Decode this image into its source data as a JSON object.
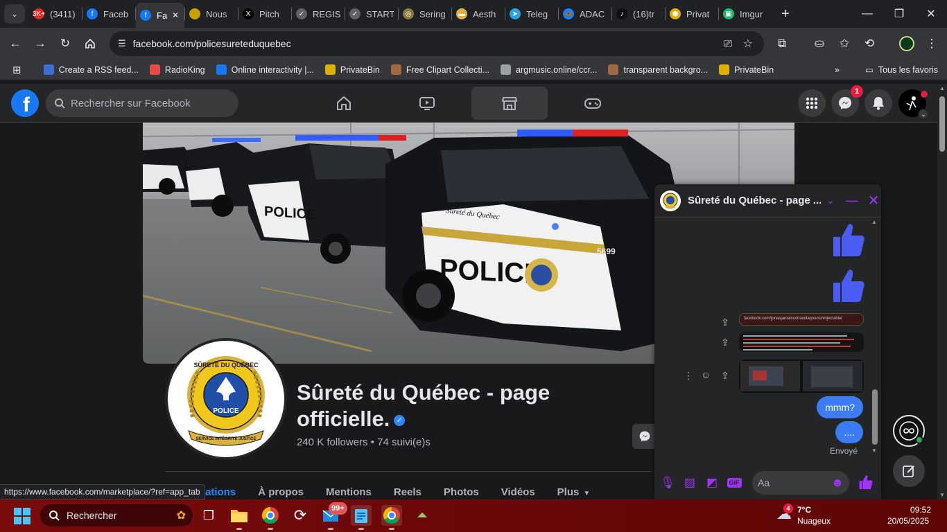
{
  "browser": {
    "tabs": [
      {
        "label": "(3411)",
        "icon": "red-badge-icon",
        "fav_text": "3K+",
        "color": "#d93025"
      },
      {
        "label": "Faceb",
        "icon": "facebook-icon",
        "fav_text": "f",
        "color": "#1877f2"
      },
      {
        "label": "Fa",
        "icon": "facebook-icon",
        "fav_text": "f",
        "color": "#1877f2",
        "active": true
      },
      {
        "label": "Nous",
        "icon": "sq-badge-icon",
        "fav_text": "",
        "color": "#c8a000"
      },
      {
        "label": "Pitch",
        "icon": "x-icon",
        "fav_text": "X",
        "color": "#000000"
      },
      {
        "label": "REGIS",
        "icon": "check-circle-icon",
        "fav_text": "✓",
        "color": "#5f6368"
      },
      {
        "label": "START",
        "icon": "check-circle-icon",
        "fav_text": "✓",
        "color": "#5f6368"
      },
      {
        "label": "Sering",
        "icon": "globe-icon",
        "fav_text": "◎",
        "color": "#8a7a40"
      },
      {
        "label": "Aesth",
        "icon": "folder-icon",
        "fav_text": "▬",
        "color": "#e0b040"
      },
      {
        "label": "Teleg",
        "icon": "telegram-icon",
        "fav_text": "➤",
        "color": "#2aa3e0"
      },
      {
        "label": "ADAC",
        "icon": "bluesky-icon",
        "fav_text": "🦋",
        "color": "#1185fe"
      },
      {
        "label": "(16)tr",
        "icon": "tiktok-icon",
        "fav_text": "♪",
        "color": "#111111"
      },
      {
        "label": "Privat",
        "icon": "privatebin-icon",
        "fav_text": "⬢",
        "color": "#e0b000"
      },
      {
        "label": "Imgur",
        "icon": "imgur-icon",
        "fav_text": "▣",
        "color": "#1bb76e"
      }
    ],
    "new_tab": "+",
    "url": "facebook.com/policesureteduquebec",
    "bookmarks": [
      {
        "label": "Create a RSS feed...",
        "icon": "rss-icon",
        "color": "#3a6fd8"
      },
      {
        "label": "RadioKing",
        "icon": "radioking-icon",
        "color": "#e84a4a"
      },
      {
        "label": "Online interactivity |...",
        "icon": "facebook-icon",
        "color": "#1877f2"
      },
      {
        "label": "PrivateBin",
        "icon": "privatebin-icon",
        "color": "#e0b000"
      },
      {
        "label": "Free Clipart Collecti...",
        "icon": "person-icon",
        "color": "#a06a40"
      },
      {
        "label": "argmusic.online/ccr...",
        "icon": "globe-icon",
        "color": "#9aa0a6"
      },
      {
        "label": "transparent backgro...",
        "icon": "person-icon",
        "color": "#a06a40"
      },
      {
        "label": "PrivateBin",
        "icon": "privatebin-icon",
        "color": "#e0b000"
      }
    ],
    "bookmarks_more": "»",
    "all_bookmarks": "Tous les favoris",
    "status_url": "https://www.facebook.com/marketplace/?ref=app_tab"
  },
  "facebook": {
    "search_placeholder": "Rechercher sur Facebook",
    "messenger_badge": "1",
    "page": {
      "name": "Sûreté du Québec - page officielle.",
      "stats": "240 K followers • 74 suivi(e)s",
      "tabs": [
        "ations",
        "À propos",
        "Mentions",
        "Reels",
        "Photos",
        "Vidéos",
        "Plus"
      ],
      "active_tab": 0,
      "logo_top": "SÛRETÉ DU QUÉBEC",
      "logo_mid": "POLICE",
      "logo_ribbon": "SERVICE INTÉGRITÉ JUSTICE",
      "car_text_police": "POLICE",
      "car_text_sq": "Sûreté du Québec",
      "car_number": "5699"
    },
    "chat": {
      "title": "Sûreté du Québec - page ...",
      "shared_link": "facebook.com/jonasjamaisconsentiepouruninjectable/",
      "messages": [
        "mmm?",
        "...."
      ],
      "status": "Envoyé",
      "input_placeholder": "Aa"
    }
  },
  "taskbar": {
    "search": "Rechercher",
    "mail_badge": "99+",
    "weather_badge": "4",
    "temperature": "7°C",
    "weather": "Nuageux",
    "time": "09:52",
    "date": "20/05/2025"
  }
}
